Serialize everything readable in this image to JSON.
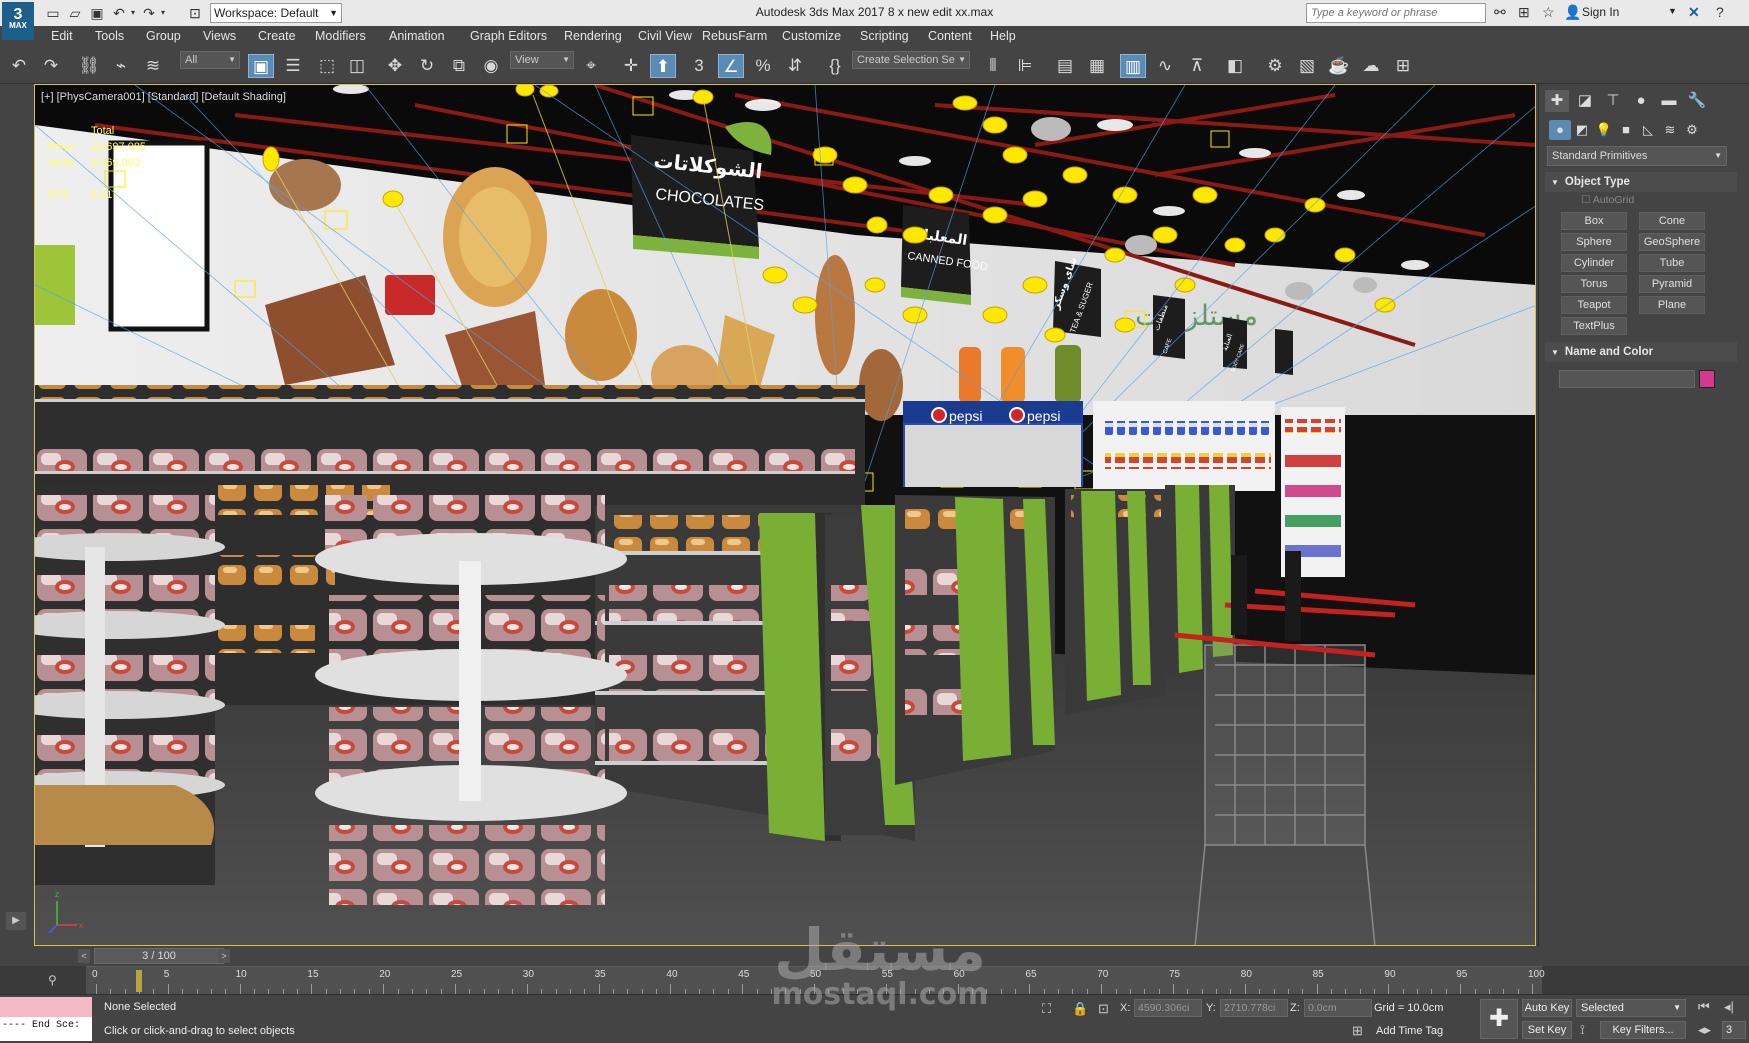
{
  "titlebar": {
    "logo_main": "3",
    "logo_sub": "MAX",
    "workspace": "Workspace: Default",
    "window_title": "Autodesk 3ds Max 2017     8 x new edit xx.max",
    "search_placeholder": "Type a keyword or phrase",
    "sign_in": "Sign In"
  },
  "menu": [
    "Edit",
    "Tools",
    "Group",
    "Views",
    "Create",
    "Modifiers",
    "Animation",
    "Graph Editors",
    "Rendering",
    "Civil View",
    "RebusFarm",
    "Customize",
    "Scripting",
    "Content",
    "Help"
  ],
  "toolbar": {
    "filter": "All",
    "ref_coord": "View",
    "named_selection": "Create Selection Se",
    "snap_label": "3",
    "angle_snap_label": "%"
  },
  "viewport": {
    "label": "[+] [PhysCamera001] [Standard] [Default Shading]",
    "stats": {
      "total_label": "Total",
      "polys_label": "Polys:",
      "polys_value": "10,697,085",
      "verts_label": "Verts:",
      "verts_value": "6,669,003",
      "fps_label": "FPS:",
      "fps_value": "9.517"
    },
    "signs": [
      {
        "ar": "الشوكلاتات",
        "en": "CHOCOLATES"
      },
      {
        "ar": "المعلبات",
        "en": "CANNED FOOD"
      },
      {
        "ar": "شاي وسكر",
        "en": "TEA & SUGER"
      },
      {
        "ar": "منظفات",
        "en": "CAFE"
      },
      {
        "ar": "العناية",
        "en": "BODY CARE"
      }
    ],
    "fridge_brand": "pepsi"
  },
  "command_panel": {
    "primitives_dropdown": "Standard Primitives",
    "object_type_title": "Object Type",
    "autogrid": "AutoGrid",
    "primitives": [
      "Box",
      "Cone",
      "Sphere",
      "GeoSphere",
      "Cylinder",
      "Tube",
      "Torus",
      "Pyramid",
      "Teapot",
      "Plane",
      "TextPlus"
    ],
    "name_color_title": "Name and Color",
    "object_color": "#d13b8e"
  },
  "timeline": {
    "frame_display": "3 / 100",
    "current_frame": 3,
    "total_frames": 100,
    "tick_labels": [
      "0",
      "5",
      "10",
      "15",
      "20",
      "25",
      "30",
      "35",
      "40",
      "45",
      "50",
      "55",
      "60",
      "65",
      "70",
      "75",
      "80",
      "85",
      "90",
      "95",
      "100"
    ]
  },
  "status": {
    "maxscript_line": "---- End Sce:",
    "selection": "None Selected",
    "hint": "Click or click-and-drag to select objects",
    "x_label": "X:",
    "x_value": "4590.306ci",
    "y_label": "Y:",
    "y_value": "2710.778ci",
    "z_label": "Z:",
    "z_value": "0.0cm",
    "grid": "Grid = 10.0cm",
    "add_time_tag": "Add Time Tag",
    "auto_key": "Auto Key",
    "set_key": "Set Key",
    "selected_dropdown": "Selected",
    "key_filters": "Key Filters...",
    "frame_field": "3"
  },
  "watermark": {
    "arabic": "مستقل",
    "latin": "mostaql.com"
  }
}
